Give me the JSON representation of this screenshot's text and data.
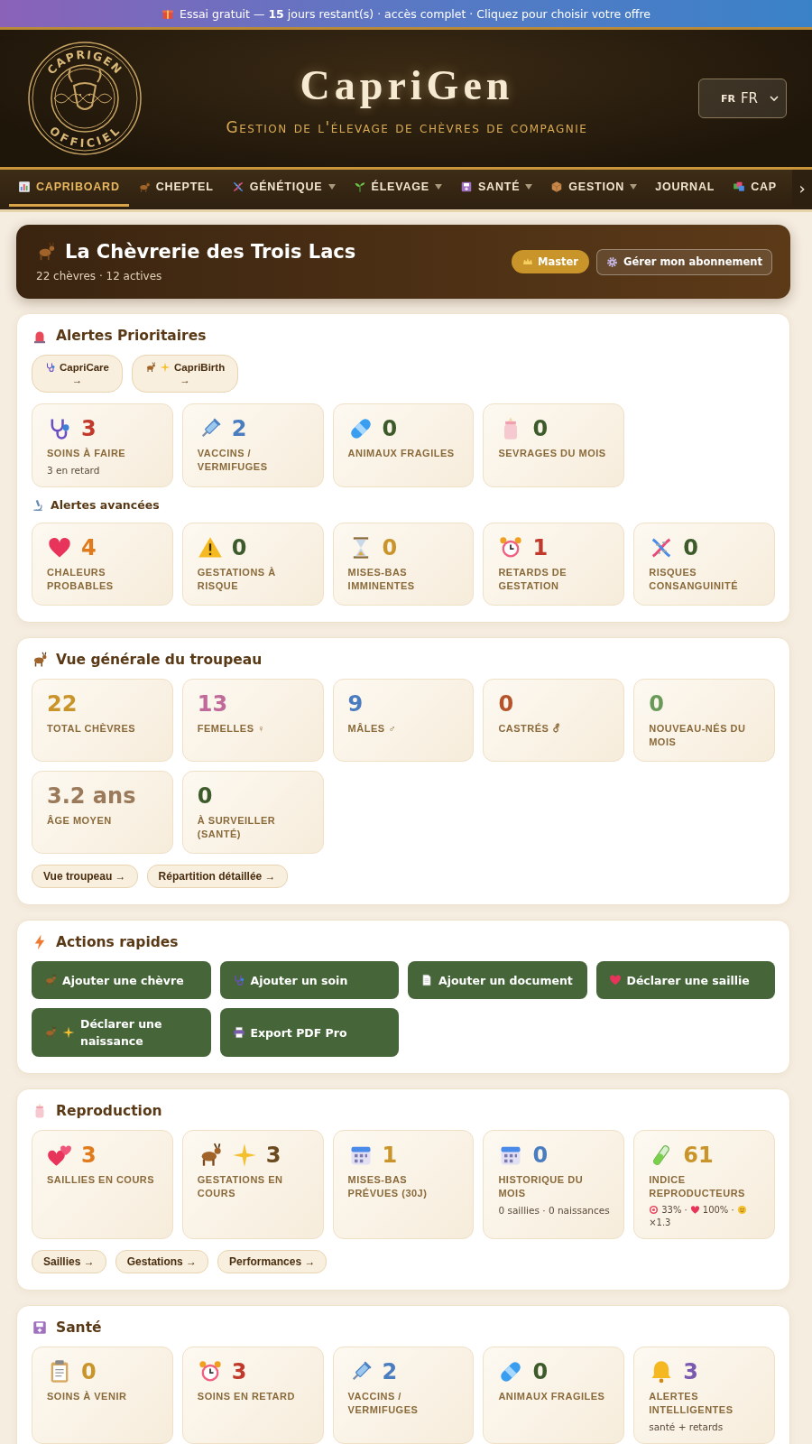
{
  "banner": {
    "text": "Essai gratuit — **15** jours restant(s) · accès complet · Cliquez pour choisir votre offre"
  },
  "header": {
    "logo_top": "CAPRIGEN",
    "logo_bottom": "OFFICIEL",
    "title": "CapriGen",
    "subtitle": "Gestion de l'élevage de chèvres de compagnie",
    "language": {
      "flag": "FR",
      "value": "FR"
    }
  },
  "nav": {
    "items": [
      {
        "label": "CAPRIBOARD",
        "selected": true,
        "dropdown": false
      },
      {
        "label": "CHEPTEL",
        "selected": false,
        "dropdown": false
      },
      {
        "label": "GÉNÉTIQUE",
        "selected": false,
        "dropdown": true
      },
      {
        "label": "ÉLEVAGE",
        "selected": false,
        "dropdown": true
      },
      {
        "label": "SANTÉ",
        "selected": false,
        "dropdown": true
      },
      {
        "label": "GESTION",
        "selected": false,
        "dropdown": true
      },
      {
        "label": "JOURNAL",
        "selected": false,
        "dropdown": false
      },
      {
        "label": "CAP",
        "selected": false,
        "dropdown": false
      }
    ],
    "scroll_arrow": "›"
  },
  "farm": {
    "name": "La Chèvrerie des Trois Lacs",
    "summary": "22 chèvres · 12 actives",
    "plan": "Master",
    "manage": "Gérer mon abonnement"
  },
  "sections": [
    {
      "kind": "alerts",
      "title": "Alertes Prioritaires",
      "chips": [
        {
          "label": "CapriCare",
          "arrow": "→"
        },
        {
          "label": "CapriBirth",
          "arrow": "→"
        }
      ],
      "groups": [
        {
          "stats": [
            {
              "value": "3",
              "label": "SOINS À FAIRE",
              "color": "#c0392b",
              "note": "3 en retard"
            },
            {
              "value": "2",
              "label": "VACCINS / VERMIFUGES",
              "color": "#4a7cc0"
            },
            {
              "value": "0",
              "label": "ANIMAUX FRAGILES",
              "color": "#3d5a2a"
            },
            {
              "value": "0",
              "label": "SEVRAGES DU MOIS",
              "color": "#3d5a2a"
            }
          ]
        },
        {
          "heading": "Alertes avancées",
          "stats": [
            {
              "value": "4",
              "label": "CHALEURS PROBABLES",
              "color": "#e07a1a"
            },
            {
              "value": "0",
              "label": "GESTATIONS À RISQUE",
              "color": "#3d5a2a"
            },
            {
              "value": "0",
              "label": "MISES-BAS IMMINENTES",
              "color": "#c9952a"
            },
            {
              "value": "1",
              "label": "RETARDS DE GESTATION",
              "color": "#c0392b"
            },
            {
              "value": "0",
              "label": "RISQUES CONSANGUINITÉ",
              "color": "#3d5a2a"
            }
          ]
        }
      ]
    },
    {
      "kind": "overview",
      "title": "Vue générale du troupeau",
      "groups": [
        {
          "stats": [
            {
              "value": "22",
              "label": "TOTAL CHÈVRES",
              "color": "#c9952a"
            },
            {
              "value": "13",
              "label": "FEMELLES ♀",
              "color": "#c06a9a"
            },
            {
              "value": "9",
              "label": "MÂLES ♂",
              "color": "#4a7cc0"
            },
            {
              "value": "0",
              "label": "CASTRÉS ⚦",
              "color": "#b5542a"
            },
            {
              "value": "0",
              "label": "NOUVEAU-NÉS DU MOIS",
              "color": "#6a9a5a"
            },
            {
              "value": "3.2 ans",
              "label": "ÂGE MOYEN",
              "color": "#9a7a5a"
            },
            {
              "value": "0",
              "label": "À SURVEILLER (SANTÉ)",
              "color": "#3d5a2a"
            }
          ]
        }
      ],
      "links": [
        "Vue troupeau →",
        "Répartition détaillée →"
      ]
    },
    {
      "kind": "actions",
      "title": "Actions rapides",
      "actions": [
        "Ajouter une chèvre",
        "Ajouter un soin",
        "Ajouter un document",
        "Déclarer une saillie",
        "Déclarer une naissance",
        "Export PDF Pro"
      ]
    },
    {
      "kind": "reproduction",
      "title": "Reproduction",
      "groups": [
        {
          "stats": [
            {
              "value": "3",
              "label": "SAILLIES EN COURS",
              "color": "#e07a1a"
            },
            {
              "value": "3",
              "label": "GESTATIONS EN COURS",
              "color": "#6a4a1e"
            },
            {
              "value": "1",
              "label": "MISES-BAS PRÉVUES (30J)",
              "color": "#c9952a"
            },
            {
              "value": "0",
              "label": "HISTORIQUE DU MOIS",
              "color": "#4a7cc0",
              "note": "0 saillies · 0 naissances"
            },
            {
              "value": "61",
              "label": "INDICE REPRODUCTEURS",
              "color": "#c9952a",
              "metrics": [
                "33% ·",
                "100% ·",
                "×1.3"
              ]
            }
          ]
        }
      ],
      "links": [
        "Saillies →",
        "Gestations →",
        "Performances →"
      ]
    },
    {
      "kind": "health",
      "title": "Santé",
      "groups": [
        {
          "stats": [
            {
              "value": "0",
              "label": "SOINS À VENIR",
              "color": "#c9952a"
            },
            {
              "value": "3",
              "label": "SOINS EN RETARD",
              "color": "#c0392b"
            },
            {
              "value": "2",
              "label": "VACCINS / VERMIFUGES",
              "color": "#4a7cc0"
            },
            {
              "value": "0",
              "label": "ANIMAUX FRAGILES",
              "color": "#3d5a2a"
            },
            {
              "value": "3",
              "label": "ALERTES INTELLIGENTES",
              "color": "#7a5ab0",
              "note": "santé + retards"
            }
          ]
        }
      ]
    }
  ]
}
